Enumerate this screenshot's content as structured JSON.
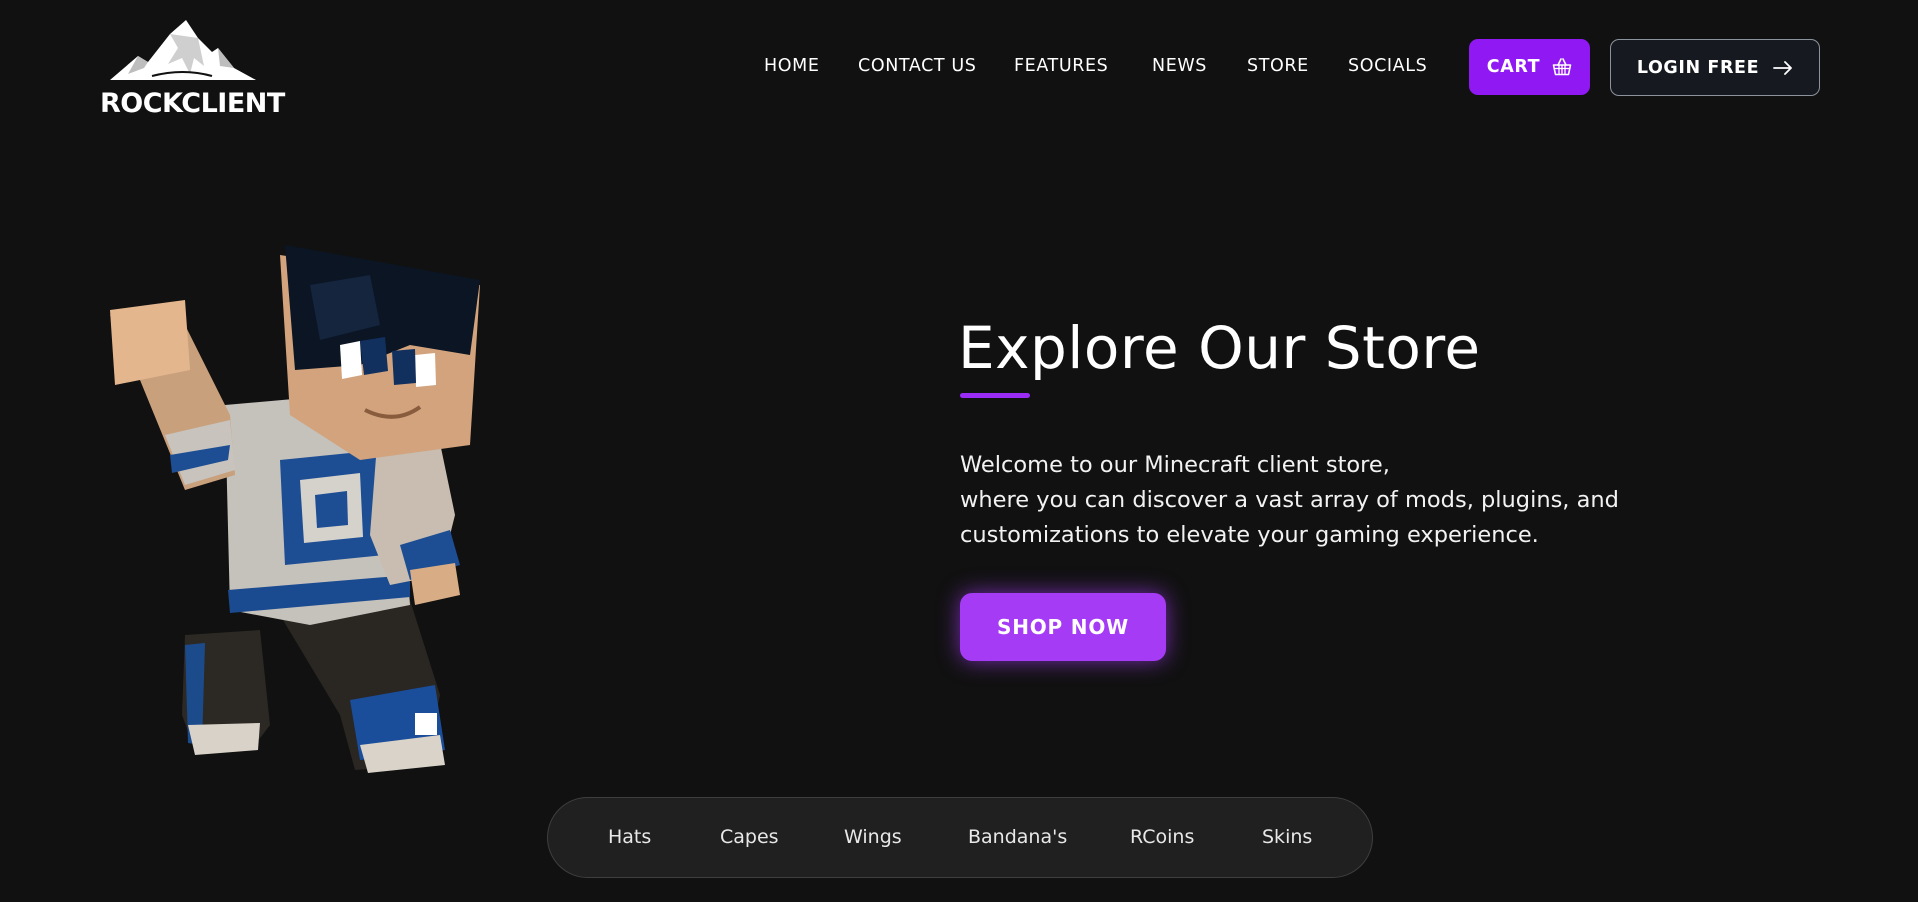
{
  "brand": {
    "name": "ROCKCLIENT",
    "logo_icon": "mountain-icon"
  },
  "nav": {
    "links": [
      "HOME",
      "CONTACT US",
      "FEATURES",
      "NEWS",
      "STORE",
      "SOCIALS"
    ],
    "cart_label": "CART",
    "cart_icon": "basket-icon",
    "login_label": "LOGIN FREE",
    "login_icon": "arrow-right-icon"
  },
  "hero": {
    "title": "Explore Our Store",
    "description_lines": [
      "Welcome to our Minecraft client store,",
      "where you can discover a vast array of mods, plugins, and",
      "customizations to elevate your gaming experience."
    ],
    "cta_label": "SHOP NOW",
    "image": "minecraft-character-illustration"
  },
  "categories": [
    "Hats",
    "Capes",
    "Wings",
    "Bandana's",
    "RCoins",
    "Skins"
  ],
  "colors": {
    "background": "#111111",
    "accent": "#9018f2",
    "cta": "#a53bf5",
    "login_bg": "#161a20",
    "category_bar": "#202020"
  }
}
